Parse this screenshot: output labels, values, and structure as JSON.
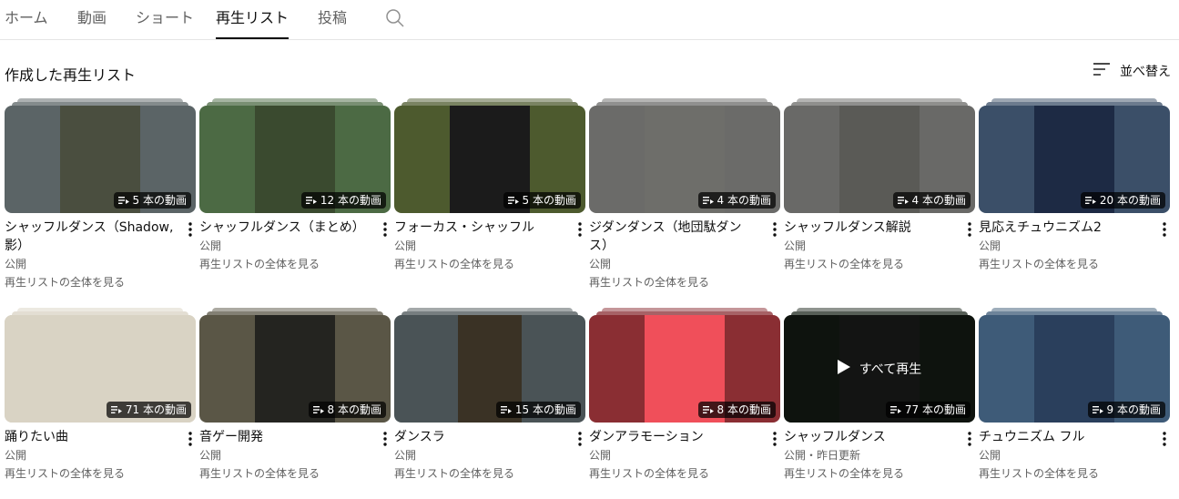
{
  "tabs": [
    {
      "label": "ホーム"
    },
    {
      "label": "動画"
    },
    {
      "label": "ショート"
    },
    {
      "label": "再生リスト"
    },
    {
      "label": "投稿"
    }
  ],
  "active_tab": "再生リスト",
  "section": {
    "title": "作成した再生リスト",
    "sort_label": "並べ替え"
  },
  "view_all_label": "再生リストの全体を見る",
  "play_all_label": "すべて再生",
  "playlists": [
    {
      "title": "シャッフルダンス（Shadow, 影）",
      "count": "5 本の動画",
      "visibility": "公開",
      "bg": "#5b6466",
      "inner": "#4a4e3f"
    },
    {
      "title": "シャッフルダンス（まとめ）",
      "count": "12 本の動画",
      "visibility": "公開",
      "bg": "#4c6a44",
      "inner": "#3a4a2f"
    },
    {
      "title": "フォーカス・シャッフル",
      "count": "5 本の動画",
      "visibility": "公開",
      "bg": "#4d5a2e",
      "inner": "#1b1b1b"
    },
    {
      "title": "ジダンダンス（地団駄ダンス）",
      "count": "4 本の動画",
      "visibility": "公開",
      "bg": "#6b6b69",
      "inner": "#6e6e6a"
    },
    {
      "title": "シャッフルダンス解説",
      "count": "4 本の動画",
      "visibility": "公開",
      "bg": "#696967",
      "inner": "#5a5a56"
    },
    {
      "title": "見応えチュウニズム2",
      "count": "20 本の動画",
      "visibility": "公開",
      "bg": "#3b4f68",
      "inner": "#1d2a44"
    },
    {
      "title": "踊りたい曲",
      "count": "71 本の動画",
      "visibility": "公開",
      "bg": "#d9d3c4",
      "inner": "#d9d3c4"
    },
    {
      "title": "音ゲー開発",
      "count": "8 本の動画",
      "visibility": "公開",
      "bg": "#5a5646",
      "inner": "#242420"
    },
    {
      "title": "ダンスラ",
      "count": "15 本の動画",
      "visibility": "公開",
      "bg": "#4a5356",
      "inner": "#3a3225"
    },
    {
      "title": "ダンアラモーション",
      "count": "8 本の動画",
      "visibility": "公開",
      "bg": "#8a2e33",
      "inner": "#f04f5a"
    },
    {
      "title": "シャッフルダンス",
      "count": "77 本の動画",
      "visibility": "公開・昨日更新",
      "bg": "#1f2a1f",
      "inner": "#2a2e2a",
      "hover": true
    },
    {
      "title": "チュウニズム フル",
      "count": "9 本の動画",
      "visibility": "公開",
      "bg": "#3e5b78",
      "inner": "#2a3f5c"
    }
  ],
  "icons": {
    "search": "search-icon",
    "sort": "sort-icon",
    "menu": "more-vert-icon",
    "playlist": "playlist-icon",
    "play": "play-icon"
  }
}
